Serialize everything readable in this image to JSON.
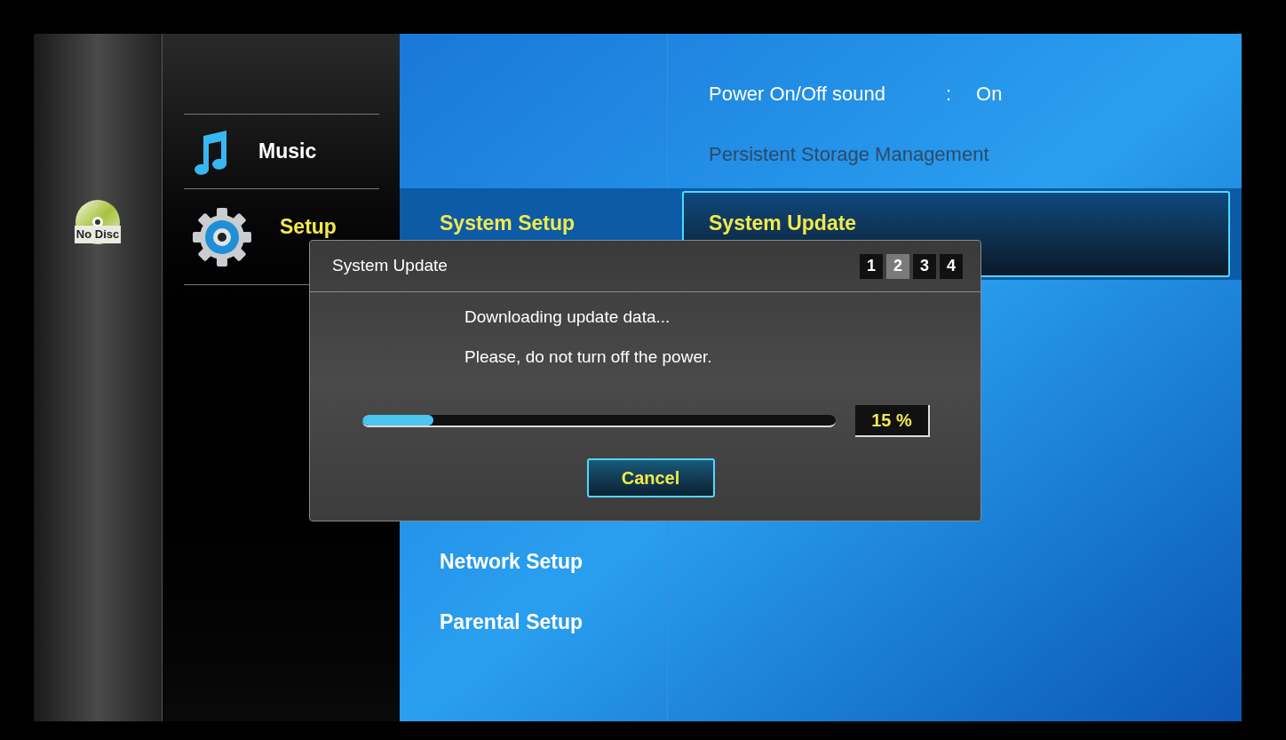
{
  "sidebar": {
    "disc_status": "No Disc"
  },
  "main_menu": [
    {
      "kind": "music",
      "label": "Music",
      "selected": false
    },
    {
      "kind": "setup",
      "label": "Setup",
      "selected": true
    }
  ],
  "submenu": [
    {
      "label": "System Setup",
      "selected": true
    },
    {
      "label": "Network Setup",
      "selected": false
    },
    {
      "label": "Parental Setup",
      "selected": false
    }
  ],
  "settings": [
    {
      "kind": "value",
      "label": "Power On/Off sound",
      "separator": ":",
      "value": "On",
      "disabled": false,
      "selected": false
    },
    {
      "kind": "link",
      "label": "Persistent Storage Management",
      "disabled": true,
      "selected": false
    },
    {
      "kind": "link",
      "label": "System Update",
      "disabled": false,
      "selected": true
    }
  ],
  "dialog": {
    "title": "System Update",
    "steps": [
      {
        "label": "1",
        "selected": false
      },
      {
        "label": "2",
        "selected": true
      },
      {
        "label": "3",
        "selected": false
      },
      {
        "label": "4",
        "selected": false
      }
    ],
    "messages": [
      "Downloading update data...",
      "Please, do not turn off the power."
    ],
    "progress": {
      "level": 0.15,
      "reading": "15 %"
    },
    "button": "Cancel"
  }
}
